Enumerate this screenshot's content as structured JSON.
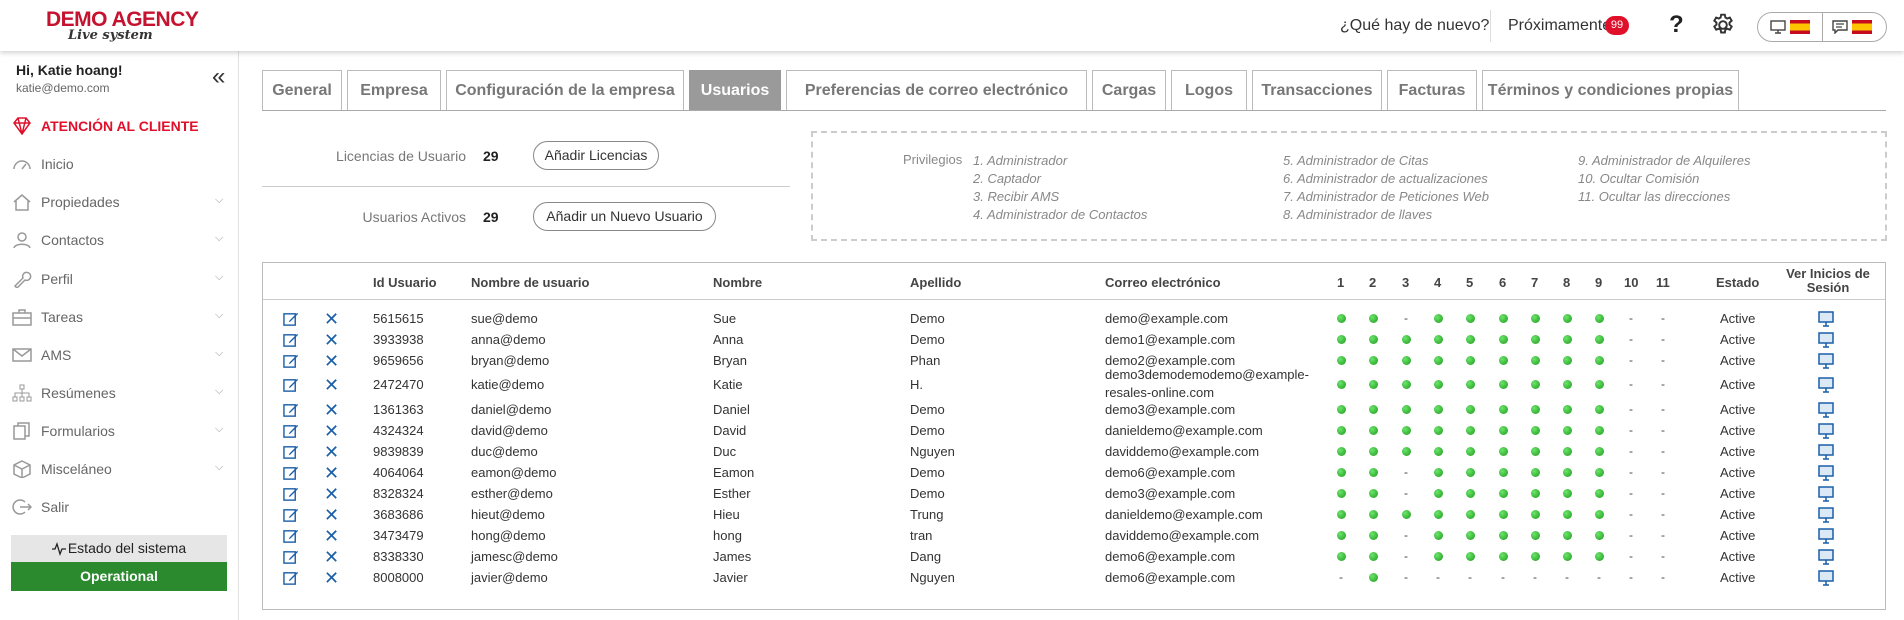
{
  "header": {
    "logo_line1": "DEMO AGENCY",
    "logo_line2": "Live system",
    "whats_new": "¿Qué hay de nuevo?",
    "upcoming": "Próximamente",
    "upcoming_count": "99",
    "help": "?"
  },
  "sidebar": {
    "greeting": "Hi, Katie hoang!",
    "email": "katie@demo.com",
    "collapse": "«",
    "support": "ATENCIÓN AL CLIENTE",
    "items": [
      {
        "label": "Inicio",
        "icon": "dashboard-icon",
        "has_children": false
      },
      {
        "label": "Propiedades",
        "icon": "home-icon",
        "has_children": true
      },
      {
        "label": "Contactos",
        "icon": "user-icon",
        "has_children": true
      },
      {
        "label": "Perfil",
        "icon": "wrench-icon",
        "has_children": true
      },
      {
        "label": "Tareas",
        "icon": "briefcase-icon",
        "has_children": true
      },
      {
        "label": "AMS",
        "icon": "mail-icon",
        "has_children": true
      },
      {
        "label": "Resúmenes",
        "icon": "sitemap-icon",
        "has_children": true
      },
      {
        "label": "Formularios",
        "icon": "copy-icon",
        "has_children": true
      },
      {
        "label": "Misceláneo",
        "icon": "box-icon",
        "has_children": true
      },
      {
        "label": "Salir",
        "icon": "logout-icon",
        "has_children": false
      }
    ],
    "status_label": "Estado del sistema",
    "status_value": "Operational"
  },
  "tabs": [
    {
      "label": "General",
      "active": false
    },
    {
      "label": "Empresa",
      "active": false
    },
    {
      "label": "Configuración de la empresa",
      "active": false
    },
    {
      "label": "Usuarios",
      "active": true
    },
    {
      "label": "Preferencias de correo electrónico",
      "active": false
    },
    {
      "label": "Cargas",
      "active": false
    },
    {
      "label": "Logos",
      "active": false
    },
    {
      "label": "Transacciones",
      "active": false
    },
    {
      "label": "Facturas",
      "active": false
    },
    {
      "label": "Términos y condiciones propias",
      "active": false
    }
  ],
  "licenses": {
    "label": "Licencias de Usuario",
    "value": "29",
    "button": "Añadir Licencias"
  },
  "active_users": {
    "label": "Usuarios Activos",
    "value": "29",
    "button": "Añadir un Nuevo Usuario"
  },
  "privileges": {
    "label": "Privilegios",
    "col1": [
      "1. Administrador",
      "2. Captador",
      "3. Recibir AMS",
      "4. Administrador de Contactos"
    ],
    "col2": [
      "5. Administrador de Citas",
      "6. Administrador de actualizaciones",
      "7. Administrador de Peticiones Web",
      "8. Administrador de llaves"
    ],
    "col3": [
      "9. Administrador de Alquileres",
      "10. Ocultar Comisión",
      "11. Ocultar las direcciones"
    ]
  },
  "table": {
    "headers": {
      "id": "Id Usuario",
      "username": "Nombre de usuario",
      "name": "Nombre",
      "surname": "Apellido",
      "email": "Correo electrónico",
      "p": [
        "1",
        "2",
        "3",
        "4",
        "5",
        "6",
        "7",
        "8",
        "9",
        "10",
        "11"
      ],
      "status": "Estado",
      "logins": "Ver Inicios de Sesión"
    },
    "rows": [
      {
        "id": "5615615",
        "user": "sue@demo",
        "name": "Sue",
        "surname": "Demo",
        "email": "demo@example.com",
        "perms": [
          1,
          1,
          0,
          1,
          1,
          1,
          1,
          1,
          1,
          0,
          0
        ],
        "status": "Active"
      },
      {
        "id": "3933938",
        "user": "anna@demo",
        "name": "Anna",
        "surname": "Demo",
        "email": "demo1@example.com",
        "perms": [
          1,
          1,
          1,
          1,
          1,
          1,
          1,
          1,
          1,
          0,
          0
        ],
        "status": "Active"
      },
      {
        "id": "9659656",
        "user": "bryan@demo",
        "name": "Bryan",
        "surname": "Phan",
        "email": "demo2@example.com",
        "perms": [
          1,
          1,
          1,
          1,
          1,
          1,
          1,
          1,
          1,
          0,
          0
        ],
        "status": "Active"
      },
      {
        "id": "2472470",
        "user": "katie@demo",
        "name": "Katie",
        "surname": "H.",
        "email": "demo3demodemodemo@example-",
        "email2": "resales-online.com",
        "perms": [
          1,
          1,
          1,
          1,
          1,
          1,
          1,
          1,
          1,
          0,
          0
        ],
        "status": "Active"
      },
      {
        "id": "1361363",
        "user": "daniel@demo",
        "name": "Daniel",
        "surname": "Demo",
        "email": "demo3@example.com",
        "perms": [
          1,
          1,
          1,
          1,
          1,
          1,
          1,
          1,
          1,
          0,
          0
        ],
        "status": "Active"
      },
      {
        "id": "4324324",
        "user": "david@demo",
        "name": "David",
        "surname": "Demo",
        "email": "danieldemo@example.com",
        "perms": [
          1,
          1,
          1,
          1,
          1,
          1,
          1,
          1,
          1,
          0,
          0
        ],
        "status": "Active"
      },
      {
        "id": "9839839",
        "user": "duc@demo",
        "name": "Duc",
        "surname": "Nguyen",
        "email": "daviddemo@example.com",
        "perms": [
          1,
          1,
          1,
          1,
          1,
          1,
          1,
          1,
          1,
          0,
          0
        ],
        "status": "Active"
      },
      {
        "id": "4064064",
        "user": "eamon@demo",
        "name": "Eamon",
        "surname": "Demo",
        "email": "demo6@example.com",
        "perms": [
          1,
          1,
          0,
          1,
          1,
          1,
          1,
          1,
          1,
          0,
          0
        ],
        "status": "Active"
      },
      {
        "id": "8328324",
        "user": "esther@demo",
        "name": "Esther",
        "surname": "Demo",
        "email": "demo3@example.com",
        "perms": [
          1,
          1,
          0,
          1,
          1,
          1,
          1,
          1,
          1,
          0,
          0
        ],
        "status": "Active"
      },
      {
        "id": "3683686",
        "user": "hieut@demo",
        "name": "Hieu",
        "surname": "Trung",
        "email": "danieldemo@example.com",
        "perms": [
          1,
          1,
          1,
          1,
          1,
          1,
          1,
          1,
          1,
          0,
          0
        ],
        "status": "Active"
      },
      {
        "id": "3473479",
        "user": "hong@demo",
        "name": "hong",
        "surname": "tran",
        "email": "daviddemo@example.com",
        "perms": [
          1,
          1,
          0,
          1,
          1,
          1,
          1,
          1,
          1,
          0,
          0
        ],
        "status": "Active"
      },
      {
        "id": "8338330",
        "user": "jamesc@demo",
        "name": "James",
        "surname": "Dang",
        "email": "demo6@example.com",
        "perms": [
          1,
          1,
          0,
          1,
          1,
          1,
          1,
          1,
          1,
          0,
          0
        ],
        "status": "Active"
      },
      {
        "id": "8008000",
        "user": "javier@demo",
        "name": "Javier",
        "surname": "Nguyen",
        "email": "demo6@example.com",
        "perms": [
          0,
          1,
          0,
          0,
          0,
          0,
          0,
          0,
          0,
          0,
          0
        ],
        "status": "Active"
      }
    ]
  },
  "colors": {
    "brand": "#c5122e",
    "badge": "#e0102b",
    "active_tab": "#9a9a9a",
    "operational": "#2b8a2e",
    "action_blue": "#1a5fa8",
    "dot_green": "#2dbb2d"
  }
}
